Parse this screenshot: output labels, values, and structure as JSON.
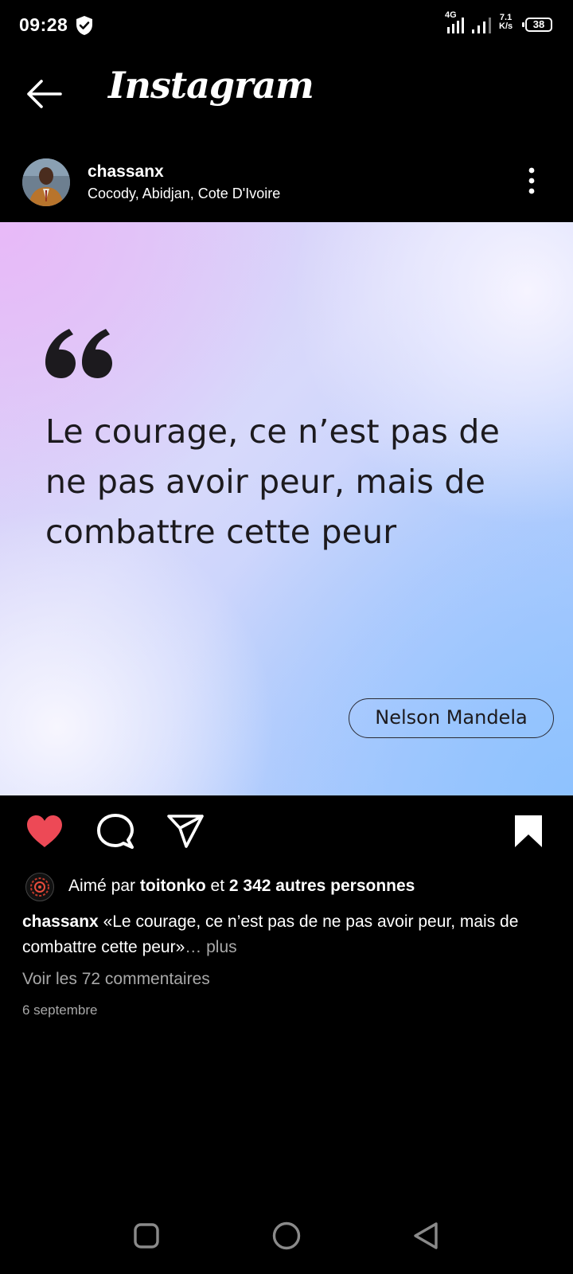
{
  "status_bar": {
    "time": "09:28",
    "network_type": "4G",
    "speed_value": "7.1",
    "speed_unit": "K/s",
    "battery": "38",
    "icons": [
      "shield-icon",
      "signal-icon",
      "signal-icon",
      "battery-icon"
    ]
  },
  "header": {
    "title": "Instagram",
    "back_icon": "back-arrow-icon"
  },
  "post": {
    "username": "chassanx",
    "location": "Cocody, Abidjan, Cote D'Ivoire",
    "menu_icon": "more-vertical-icon",
    "image": {
      "quote": "Le courage, ce n’est pas de ne pas avoir peur, mais de combattre cette peur",
      "author": "Nelson Mandela"
    },
    "actions": {
      "liked": true,
      "saved": true,
      "like_color": "#ed4956",
      "icons": [
        "heart-icon",
        "comment-icon",
        "share-icon",
        "bookmark-icon"
      ]
    },
    "likes": {
      "prefix": "Aimé par",
      "user": "toitonko",
      "connector": "et",
      "others": "2 342 autres personnes"
    },
    "caption": {
      "user": "chassanx",
      "text": "«Le courage, ce n’est pas de ne pas avoir peur, mais de combattre cette peur»",
      "more": "… plus"
    },
    "comments_link": "Voir les 72 commentaires",
    "date": "6 septembre"
  },
  "colors": {
    "background": "#000000",
    "muted_text": "#a8a8a8",
    "quote_text": "#1c1a1e"
  },
  "navbar": {
    "icons": [
      "recent-apps-icon",
      "home-icon",
      "back-icon"
    ]
  }
}
